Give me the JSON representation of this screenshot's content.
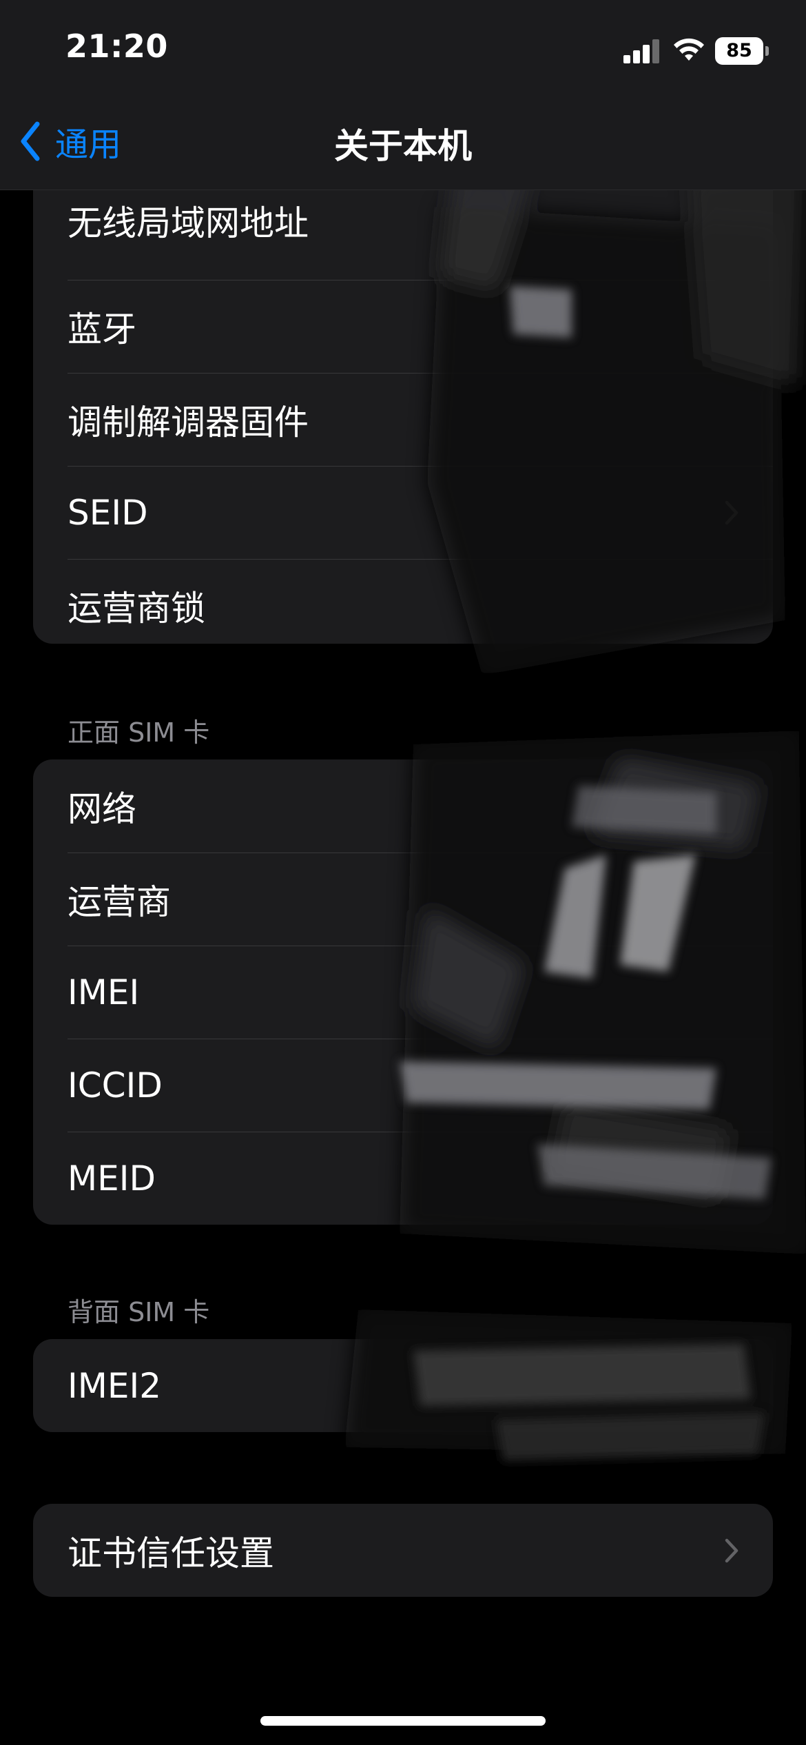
{
  "status_bar": {
    "time": "21:20",
    "battery_level": "85",
    "icons": [
      "cellular-signal-icon",
      "wifi-icon",
      "battery-icon"
    ]
  },
  "nav": {
    "back_label": "通用",
    "title": "关于本机"
  },
  "group_top": {
    "rows": [
      {
        "label": "无线局域网地址",
        "chevron": false
      },
      {
        "label": "蓝牙",
        "chevron": false
      },
      {
        "label": "调制解调器固件",
        "chevron": false
      },
      {
        "label": "SEID",
        "chevron": true
      },
      {
        "label": "运营商锁",
        "chevron": false
      }
    ]
  },
  "front_sim": {
    "header": "正面 SIM 卡",
    "rows": [
      {
        "label": "网络"
      },
      {
        "label": "运营商"
      },
      {
        "label": "IMEI"
      },
      {
        "label": "ICCID"
      },
      {
        "label": "MEID"
      }
    ]
  },
  "back_sim": {
    "header": "背面 SIM 卡",
    "rows": [
      {
        "label": "IMEI2"
      }
    ]
  },
  "certificate": {
    "label": "证书信任设置"
  },
  "colors": {
    "background": "#000000",
    "group_background": "#1c1c1e",
    "accent": "#0a84ff",
    "secondary_text": "#8d8d93",
    "separator": "#38383a"
  }
}
